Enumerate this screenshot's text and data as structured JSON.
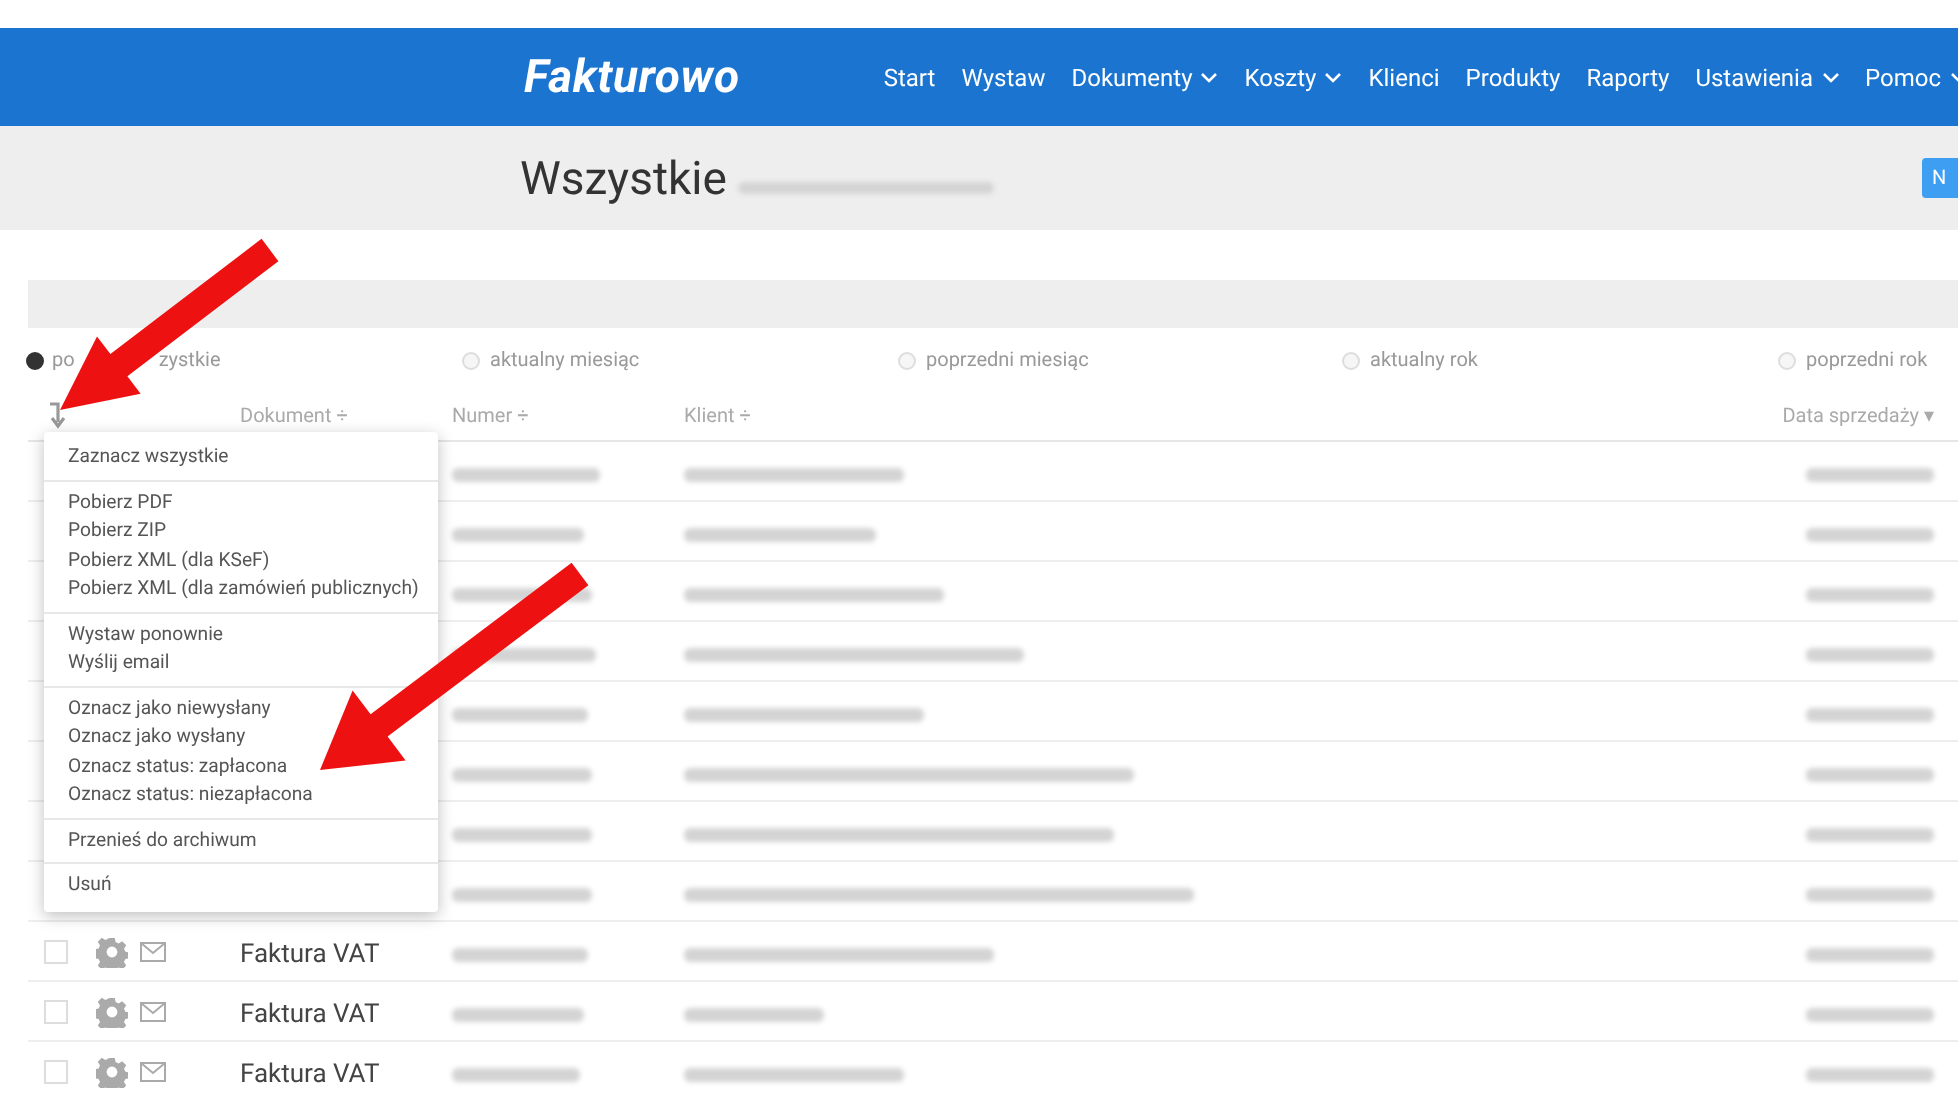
{
  "navbar": {
    "logo": "Fakturowo",
    "items": [
      {
        "label": "Start",
        "dropdown": false
      },
      {
        "label": "Wystaw",
        "dropdown": false
      },
      {
        "label": "Dokumenty",
        "dropdown": true
      },
      {
        "label": "Koszty",
        "dropdown": true
      },
      {
        "label": "Klienci",
        "dropdown": false
      },
      {
        "label": "Produkty",
        "dropdown": false
      },
      {
        "label": "Raporty",
        "dropdown": false
      },
      {
        "label": "Ustawienia",
        "dropdown": true
      },
      {
        "label": "Pomoc",
        "dropdown": true
      }
    ]
  },
  "header": {
    "title": "Wszystkie",
    "button": "N"
  },
  "period_filter": [
    {
      "label_parts": [
        "po",
        "zystkie"
      ],
      "selected": true
    },
    {
      "label": "aktualny miesiąc",
      "selected": false
    },
    {
      "label": "poprzedni miesiąc",
      "selected": false
    },
    {
      "label": "aktualny rok",
      "selected": false
    },
    {
      "label": "poprzedni rok",
      "selected": false
    }
  ],
  "table": {
    "columns": [
      "Dokument ÷",
      "Numer ÷",
      "Klient ÷",
      "Data sprzedaży ▾"
    ],
    "rows": [
      {
        "kind": "covered"
      },
      {
        "kind": "covered"
      },
      {
        "kind": "covered"
      },
      {
        "kind": "covered"
      },
      {
        "kind": "covered"
      },
      {
        "kind": "covered"
      },
      {
        "kind": "covered"
      },
      {
        "kind": "covered"
      },
      {
        "kind": "full",
        "checked": false,
        "document": "Faktura VAT"
      },
      {
        "kind": "full",
        "checked": false,
        "document": "Faktura VAT"
      },
      {
        "kind": "full",
        "checked": false,
        "document": "Faktura VAT"
      }
    ]
  },
  "bulk_menu": {
    "groups": [
      [
        "Zaznacz wszystkie"
      ],
      [
        "Pobierz PDF",
        "Pobierz ZIP",
        "Pobierz XML (dla KSeF)",
        "Pobierz XML (dla zamówień publicznych)"
      ],
      [
        "Wystaw ponownie",
        "Wyślij email"
      ],
      [
        "Oznacz jako niewysłany",
        "Oznacz jako wysłany",
        "Oznacz status: zapłacona",
        "Oznacz status: niezapłacona"
      ],
      [
        "Przenieś do archiwum"
      ],
      [
        "Usuń"
      ]
    ]
  }
}
